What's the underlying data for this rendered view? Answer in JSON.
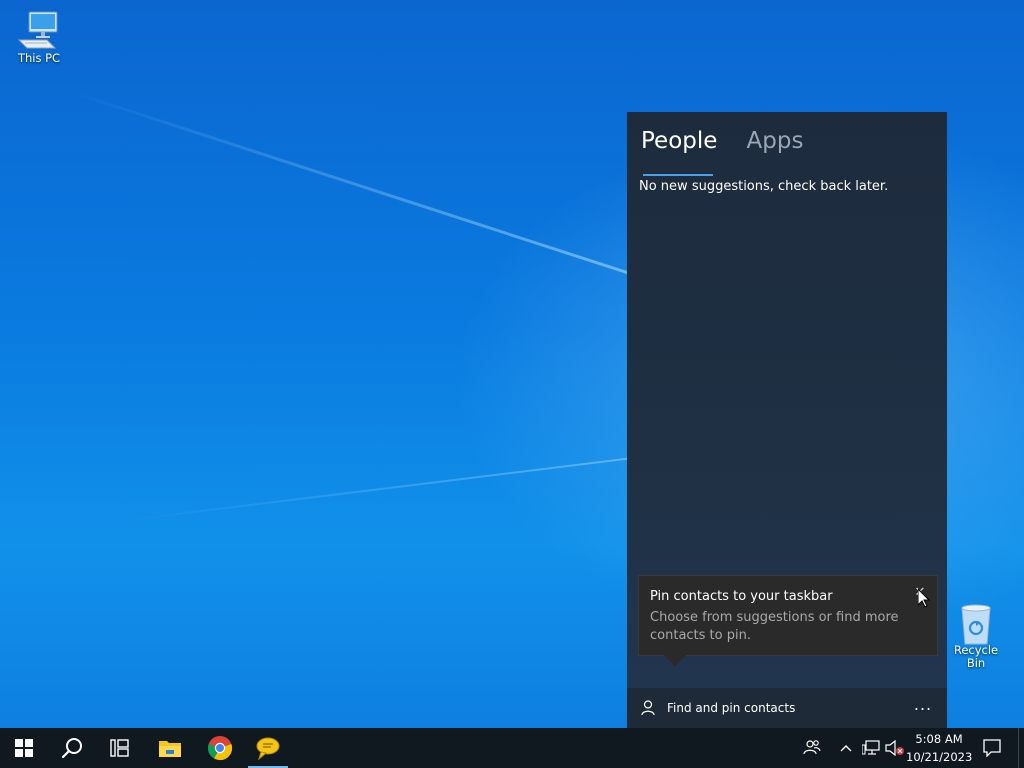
{
  "desktop": {
    "icons": [
      {
        "label": "This PC"
      },
      {
        "label": "Recycle Bin"
      }
    ]
  },
  "people_panel": {
    "tabs": [
      {
        "label": "People",
        "active": true
      },
      {
        "label": "Apps",
        "active": false
      }
    ],
    "suggestions_message": "No new suggestions, check back later.",
    "tip": {
      "title": "Pin contacts to your taskbar",
      "body": "Choose from suggestions or find more contacts to pin."
    },
    "footer": {
      "find_pin_label": "Find and pin contacts",
      "more_label": "..."
    }
  },
  "taskbar": {
    "apps": [
      {
        "name": "start",
        "icon": "windows-logo-icon"
      },
      {
        "name": "search",
        "icon": "search-icon"
      },
      {
        "name": "task-view",
        "icon": "task-view-icon"
      },
      {
        "name": "file-explorer",
        "icon": "folder-icon"
      },
      {
        "name": "chrome",
        "icon": "chrome-icon"
      },
      {
        "name": "sticky-app",
        "icon": "speech-bubble-icon",
        "active": true
      }
    ],
    "tray": {
      "icons": [
        "people-icon",
        "chevron-up-icon",
        "network-icon",
        "volume-muted-icon",
        "notification-icon"
      ]
    },
    "clock": {
      "time": "5:08 AM",
      "date": "10/21/2023"
    }
  },
  "colors": {
    "accent": "#4a9eea",
    "panel_bg": "#1f3044",
    "taskbar_bg": "#101820"
  }
}
